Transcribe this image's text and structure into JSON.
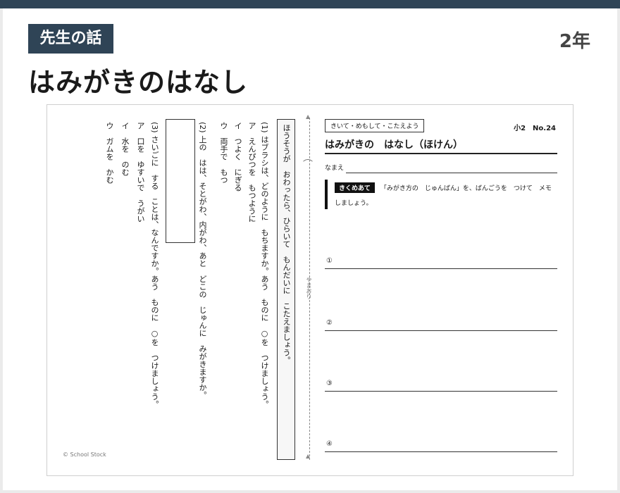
{
  "header": {
    "badge": "先生の話",
    "grade": "2年",
    "title": "はみがきのはなし"
  },
  "worksheet": {
    "instructions_vertical": "ほうそうが　おわったら、ひらいて　もんだいに　こたえましょう。",
    "q1": {
      "prompt": "(1) はブラシは、どのように　もちますか。あう　ものに　○を　つけましょう。",
      "options": [
        "ア　えんぴつを　もつように",
        "イ　つよく　にぎる",
        "ウ　両手で　もつ"
      ]
    },
    "q2": {
      "prompt": "(2) 上の　はは、そとがわ、内がわ、あと　どこの　じゅんに　みがきますか。"
    },
    "q3": {
      "prompt": "(3) さいごに　する　ことは、なんですか。あう　ものに　○を　つけましょう。",
      "options": [
        "ア　口を　ゆすいで　うがい",
        "イ　水を　のむ",
        "ウ　ガムを　かむ"
      ]
    },
    "copyright": "© School Stock",
    "fold": {
      "icon": "⌒",
      "label": "やまおり",
      "arrow_top": "▲",
      "arrow_bottom": "▲"
    },
    "right": {
      "tag": "きいて・めもして・こたえよう",
      "number": "小2　No.24",
      "subtitle": "はみがきの　はなし（ほけん）",
      "name_label": "なまえ",
      "kikume_tag": "きくめあて",
      "kikume_text": "「みがき方の　じゅんばん」を、ばんごうを　つけて　メモしましょう。",
      "numbers": [
        "①",
        "②",
        "③",
        "④"
      ]
    }
  }
}
